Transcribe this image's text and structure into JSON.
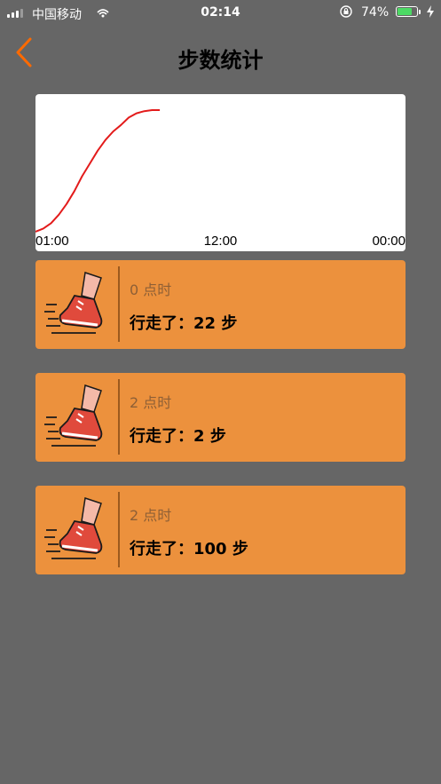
{
  "status_bar": {
    "carrier": "中国移动",
    "time": "02:14",
    "battery_percent": "74%",
    "battery_level": 0.74,
    "icons": [
      "signal-icon",
      "wifi-icon",
      "orientation-lock-icon",
      "battery-icon",
      "charging-icon"
    ]
  },
  "header": {
    "title": "步数统计",
    "back_icon": "chevron-left-icon"
  },
  "chart_data": {
    "type": "line",
    "x_ticks": [
      "01:00",
      "12:00",
      "00:00"
    ],
    "series": [
      {
        "color": "#e31b1b",
        "x": [
          0,
          0.5,
          1,
          1.5,
          2,
          2.5,
          3,
          3.5,
          4,
          4.5,
          5,
          5.5,
          6,
          6.5,
          7,
          7.5,
          8
        ],
        "values": [
          0,
          3,
          8,
          16,
          26,
          38,
          52,
          64,
          76,
          86,
          94,
          100,
          107,
          111,
          113,
          114,
          114
        ]
      }
    ],
    "ylim": [
      0,
      124
    ],
    "grid": false
  },
  "steps": [
    {
      "hour": "0 点时",
      "prefix": "行走了：",
      "count": "22",
      "unit": "步"
    },
    {
      "hour": "2 点时",
      "prefix": "行走了：",
      "count": "2",
      "unit": "步"
    },
    {
      "hour": "2 点时",
      "prefix": "行走了：",
      "count": "100",
      "unit": "步"
    }
  ],
  "colors": {
    "background": "#666666",
    "card": "#ec913d",
    "accent": "#ff6a00",
    "chart_line": "#e31b1b"
  }
}
